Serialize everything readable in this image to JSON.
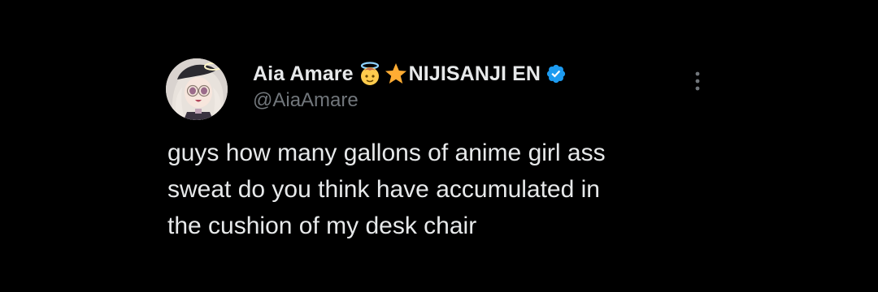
{
  "tweet": {
    "display_name": "Aia Amare ",
    "affiliation": "NIJISANJI EN",
    "handle": "@AiaAmare",
    "text": "guys how many gallons of anime girl ass\nsweat do you think have accumulated in\nthe cushion of my desk chair",
    "icons": {
      "angel_emoji": "angel-emoji-icon",
      "star_emoji": "star-emoji-icon",
      "verified_badge": "verified-badge-icon",
      "more": "more-options-icon"
    }
  },
  "colors": {
    "background": "#000000",
    "text_primary": "#e7e9ea",
    "text_secondary": "#71767b",
    "verified_blue": "#1d9bf0"
  }
}
